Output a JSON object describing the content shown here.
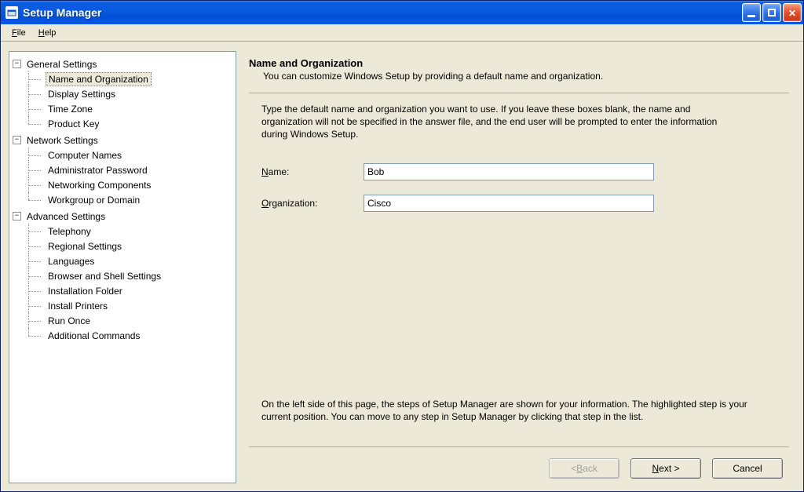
{
  "window": {
    "title": "Setup Manager"
  },
  "menubar": {
    "file": "File",
    "help": "Help"
  },
  "tree": {
    "general": {
      "label": "General Settings",
      "items": [
        "Name and Organization",
        "Display Settings",
        "Time Zone",
        "Product Key"
      ],
      "selected_index": 0
    },
    "network": {
      "label": "Network Settings",
      "items": [
        "Computer Names",
        "Administrator Password",
        "Networking Components",
        "Workgroup or Domain"
      ]
    },
    "advanced": {
      "label": "Advanced Settings",
      "items": [
        "Telephony",
        "Regional Settings",
        "Languages",
        "Browser and Shell Settings",
        "Installation Folder",
        "Install Printers",
        "Run Once",
        "Additional Commands"
      ]
    }
  },
  "main": {
    "heading": "Name and Organization",
    "subheading": "You can customize Windows Setup by providing a default name and organization.",
    "instructions": "Type the default name and organization you want to use. If you leave these boxes blank, the name and organization will not be specified in the answer file, and the end user will be prompted to enter the information during Windows Setup.",
    "name_label": "Name:",
    "name_value": "Bob",
    "org_label": "Organization:",
    "org_value": "Cisco",
    "lower_instr": "On the left side of this page, the steps of Setup Manager are shown for your information. The highlighted step is your current position. You can move to any step in Setup Manager by clicking that step in the list."
  },
  "buttons": {
    "back": "< Back",
    "next": "Next >",
    "cancel": "Cancel"
  }
}
